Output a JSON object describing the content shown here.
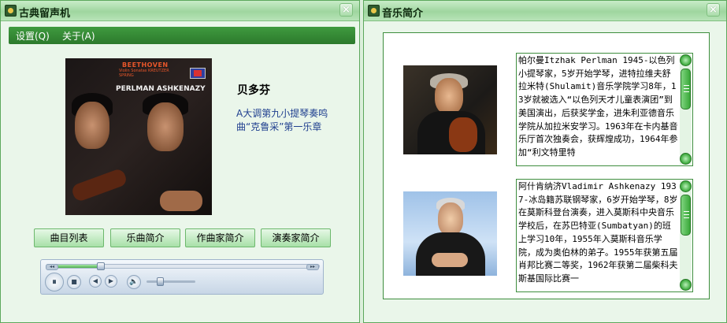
{
  "left_window": {
    "title": "古典留声机",
    "close_glyph": "×",
    "menu": {
      "settings": "设置(Q)",
      "about": "关于(A)"
    },
    "album": {
      "composer": "BEETHOVEN",
      "subtitle": "Violin Sonatas KREUTZER SPRING",
      "artists": "PERLMAN ASHKENAZY"
    },
    "composer_name": "贝多芬",
    "piece_description": "A大调第九小提琴奏鸣曲“克鲁采”第一乐章",
    "buttons": {
      "tracklist": "曲目列表",
      "piece_intro": "乐曲简介",
      "composer_intro": "作曲家简介",
      "performer_intro": "演奏家简介"
    },
    "player": {
      "play_pause_glyph": "⏸",
      "stop_glyph": "■",
      "prev_glyph": "◀",
      "next_glyph": "▶",
      "volume_glyph": "🔈",
      "seek_left_glyph": "◂◂",
      "seek_right_glyph": "▸▸",
      "progress": 0.2,
      "volume": 0.28
    }
  },
  "right_window": {
    "title": "音乐简介",
    "close_glyph": "×",
    "bios": [
      {
        "text": "帕尔曼Itzhak Perlman 1945-以色列小提琴家，5岁开始学琴，进特拉维夫舒拉米特(Shulamit)音乐学院学习8年，13岁就被选入“以色列天才儿童表演团”到美国演出，后获奖学金，进朱利亚德音乐学院从加拉米安学习。1963年在卡内基音乐厅首次独奏会，获辉煌成功，1964年参加“利文特里特"
      },
      {
        "text": "阿什肯纳济Vladimir Ashkenazy 1937-冰岛籍苏联钢琴家，6岁开始学琴，8岁在莫斯科登台演奏，进入莫斯科中央音乐学校后，在苏巴特亚(Sumbatyan)的班上学习10年，1955年入莫斯科音乐学院，成为奥伯林的弟子。1955年获第五届肖邦比赛二等奖，1962年获第二届柴科夫斯基国际比赛一"
      }
    ]
  },
  "colors": {
    "window_bg": "#eaf6ea",
    "titlebar": "#9fd69f",
    "menubar": "#2c7a2c",
    "accent_text": "#1f3f8f"
  }
}
